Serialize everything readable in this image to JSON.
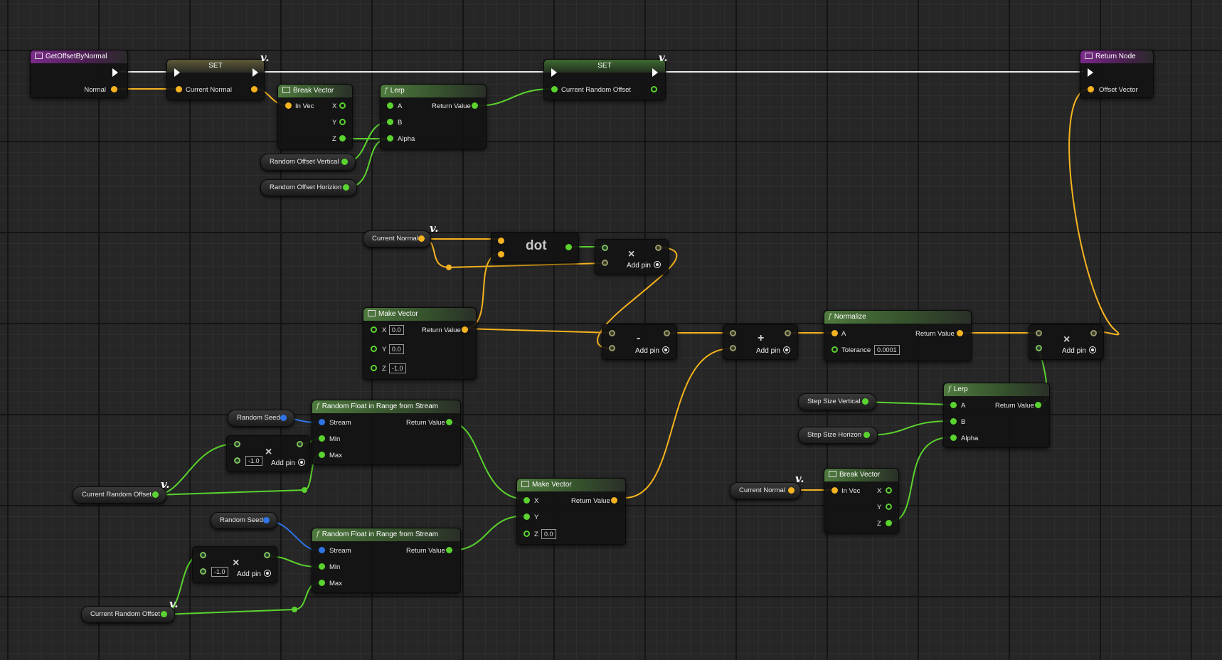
{
  "nodes": {
    "get_offset": {
      "title": "GetOffsetByNormal",
      "pin_normal": "Normal"
    },
    "set1": {
      "title": "SET",
      "pin": "Current Normal"
    },
    "break1": {
      "title": "Break Vector",
      "in": "In Vec",
      "x": "X",
      "y": "Y",
      "z": "Z"
    },
    "lerp1": {
      "title": "Lerp",
      "a": "A",
      "b": "B",
      "alpha": "Alpha",
      "ret": "Return Value"
    },
    "set2": {
      "title": "SET",
      "pin": "Current Random Offset"
    },
    "return_node": {
      "title": "Return Node",
      "pin": "Offset Vector"
    },
    "dot_node": {
      "title": "dot"
    },
    "mul1": {
      "op": "×",
      "add_pin": "Add pin"
    },
    "make_vec1": {
      "title": "Make Vector",
      "x": "X",
      "y": "Y",
      "z": "Z",
      "x_val": "0.0",
      "y_val": "0.0",
      "z_val": "-1.0",
      "ret": "Return Value"
    },
    "sub1": {
      "op": "-",
      "add_pin": "Add pin"
    },
    "add1": {
      "op": "+",
      "add_pin": "Add pin"
    },
    "normalize": {
      "title": "Normalize",
      "a": "A",
      "tol": "Tolerance",
      "tol_val": "0.0001",
      "ret": "Return Value"
    },
    "mul2": {
      "op": "×",
      "add_pin": "Add pin"
    },
    "lerp2": {
      "title": "Lerp",
      "a": "A",
      "b": "B",
      "alpha": "Alpha",
      "ret": "Return Value"
    },
    "break2": {
      "title": "Break Vector",
      "in": "In Vec",
      "x": "X",
      "y": "Y",
      "z": "Z"
    },
    "rand1": {
      "title": "Random Float in Range from Stream",
      "stream": "Stream",
      "min": "Min",
      "max": "Max",
      "ret": "Return Value"
    },
    "rand2": {
      "title": "Random Float in Range from Stream",
      "stream": "Stream",
      "min": "Min",
      "max": "Max",
      "ret": "Return Value"
    },
    "mul3": {
      "op": "×",
      "val": "-1.0",
      "add_pin": "Add pin"
    },
    "mul4": {
      "op": "×",
      "val": "-1.0",
      "add_pin": "Add pin"
    },
    "make_vec2": {
      "title": "Make Vector",
      "x": "X",
      "y": "Y",
      "z": "Z",
      "z_val": "0.0",
      "ret": "Return Value"
    }
  },
  "variables": {
    "rov": "Random Offset Vertical",
    "roh": "Random Offset Horizion",
    "cn1": "Current Normal",
    "seed1": "Random Seed",
    "seed2": "Random Seed",
    "cro1": "Current Random Offset",
    "cro2": "Current Random Offset",
    "ssv": "Step Size Vertical",
    "ssh": "Step Size Horizon",
    "cn2": "Current Normal"
  },
  "colors": {
    "exec": "#ffffff",
    "vector": "#f5b31f",
    "float": "#5ad32e",
    "struct": "#2f74e8",
    "function_header": "#4f7a3e",
    "entry_header": "#7a2a8a"
  }
}
